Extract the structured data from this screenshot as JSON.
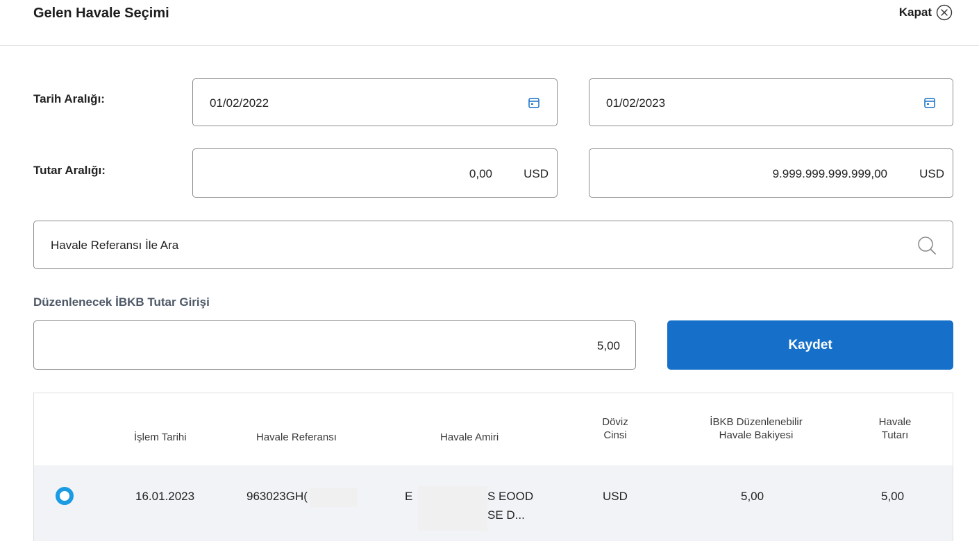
{
  "header": {
    "title": "Gelen Havale Seçimi",
    "close_label": "Kapat"
  },
  "date_range": {
    "label": "Tarih Aralığı:",
    "start": "01/02/2022",
    "end": "01/02/2023"
  },
  "amount_range": {
    "label": "Tutar Aralığı:",
    "min": "0,00",
    "max": "9.999.999.999.999,00",
    "currency": "USD"
  },
  "search": {
    "placeholder": "Havale Referansı İle Ara"
  },
  "ibkb": {
    "label": "Düzenlenecek İBKB Tutar Girişi",
    "value": "5,00",
    "save_label": "Kaydet"
  },
  "table": {
    "headers": {
      "date": "İşlem Tarihi",
      "reference": "Havale Referansı",
      "originator": "Havale Amiri",
      "currency_l1": "Döviz",
      "currency_l2": "Cinsi",
      "balance_l1": "İBKB Düzenlenebilir",
      "balance_l2": "Havale Bakiyesi",
      "amount_l1": "Havale",
      "amount_l2": "Tutarı"
    },
    "rows": [
      {
        "date": "16.01.2023",
        "reference": "963023GH(",
        "originator_l1_a": "E",
        "originator_l1_b": "S EOOD",
        "originator_l2": "SE D...",
        "currency": "USD",
        "balance": "5,00",
        "amount": "5,00"
      }
    ]
  }
}
